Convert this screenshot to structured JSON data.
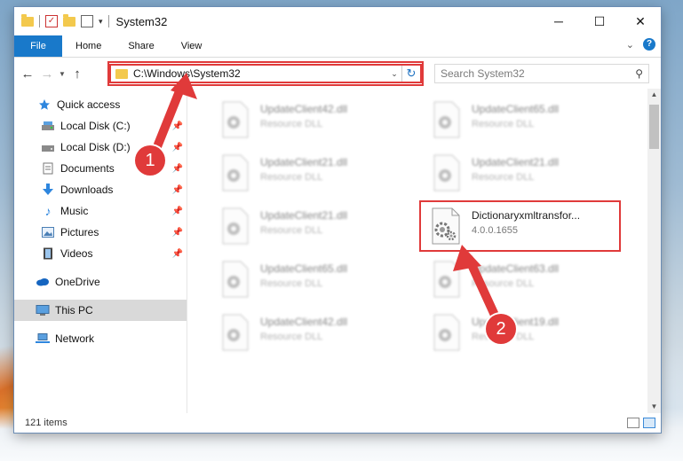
{
  "window": {
    "title": "System32"
  },
  "window_controls": {
    "minimize": "─",
    "maximize": "☐",
    "close": "✕"
  },
  "ribbon": {
    "tabs": [
      "File",
      "Home",
      "Share",
      "View"
    ],
    "help": "?"
  },
  "address": {
    "path": "C:\\Windows\\System32"
  },
  "search": {
    "placeholder": "Search System32"
  },
  "sidebar": {
    "items": [
      {
        "label": "Quick access",
        "icon": "star-icon",
        "pinned": false
      },
      {
        "label": "Local Disk (C:)",
        "icon": "drive-icon",
        "pinned": true
      },
      {
        "label": "Local Disk (D:)",
        "icon": "drive-icon",
        "pinned": true
      },
      {
        "label": "Documents",
        "icon": "documents-icon",
        "pinned": true
      },
      {
        "label": "Downloads",
        "icon": "download-arrow-icon",
        "pinned": true
      },
      {
        "label": "Music",
        "icon": "music-note-icon",
        "pinned": true
      },
      {
        "label": "Pictures",
        "icon": "pictures-icon",
        "pinned": true
      },
      {
        "label": "Videos",
        "icon": "video-icon",
        "pinned": true
      },
      {
        "label": "OneDrive",
        "icon": "cloud-icon",
        "pinned": false
      },
      {
        "label": "This PC",
        "icon": "computer-icon",
        "pinned": false
      },
      {
        "label": "Network",
        "icon": "network-icon",
        "pinned": false
      }
    ]
  },
  "files": [
    {
      "name": "UpdateClient42.dll",
      "desc": "Resource DLL",
      "blurred": true
    },
    {
      "name": "UpdateClient65.dll",
      "desc": "Resource DLL",
      "blurred": true
    },
    {
      "name": "UpdateClient21.dll",
      "desc": "Resource DLL",
      "blurred": true
    },
    {
      "name": "UpdateClient21.dll",
      "desc": "Resource DLL",
      "blurred": true
    },
    {
      "name": "UpdateClient21.dll",
      "desc": "Resource DLL",
      "blurred": true
    },
    {
      "name": "Dictionaryxmltransfor...",
      "desc": "4.0.0.1655",
      "blurred": false
    },
    {
      "name": "UpdateClient65.dll",
      "desc": "Resource DLL",
      "blurred": true
    },
    {
      "name": "UpdateClient63.dll",
      "desc": "Resource DLL",
      "blurred": true
    },
    {
      "name": "UpdateClient42.dll",
      "desc": "Resource DLL",
      "blurred": true
    },
    {
      "name": "UpdateClient19.dll",
      "desc": "Resource DLL",
      "blurred": true
    }
  ],
  "status": {
    "item_count": "121 items"
  },
  "annotations": {
    "step1": "1",
    "step2": "2"
  },
  "colors": {
    "accent": "#1979ca",
    "annotation": "#e03a3a",
    "folder": "#f3c94d"
  }
}
